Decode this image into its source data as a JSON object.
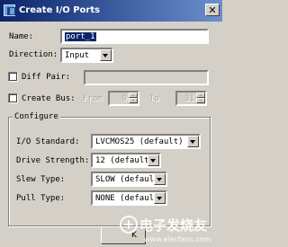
{
  "window": {
    "title": "Create I/O Ports"
  },
  "form": {
    "name_label": "Name:",
    "name_value": "port_1",
    "direction_label": "Direction:",
    "direction_value": "Input",
    "diff_pair_label": "Diff Pair:",
    "diff_pair_value": "",
    "create_bus_label": "Create Bus:",
    "from_label": "From",
    "from_value": "0",
    "to_label": "To",
    "to_value": "31"
  },
  "configure": {
    "title": "Configure",
    "io_standard_label": "I/O Standard:",
    "io_standard_value": "LVCMOS25 (default)",
    "drive_strength_label": "Drive Strength:",
    "drive_strength_value": "12 (default)",
    "slew_type_label": "Slew Type:",
    "slew_type_value": "SLOW (default)",
    "pull_type_label": "Pull Type:",
    "pull_type_value": "NONE (default)"
  },
  "buttons": {
    "ok_label": "K"
  },
  "watermark": {
    "logo_text": "电子发烧友",
    "url": "www.elecfans.com"
  },
  "colors": {
    "titlebar": "#0a246a",
    "face": "#d4d0c8",
    "selection": "#0a246a"
  }
}
